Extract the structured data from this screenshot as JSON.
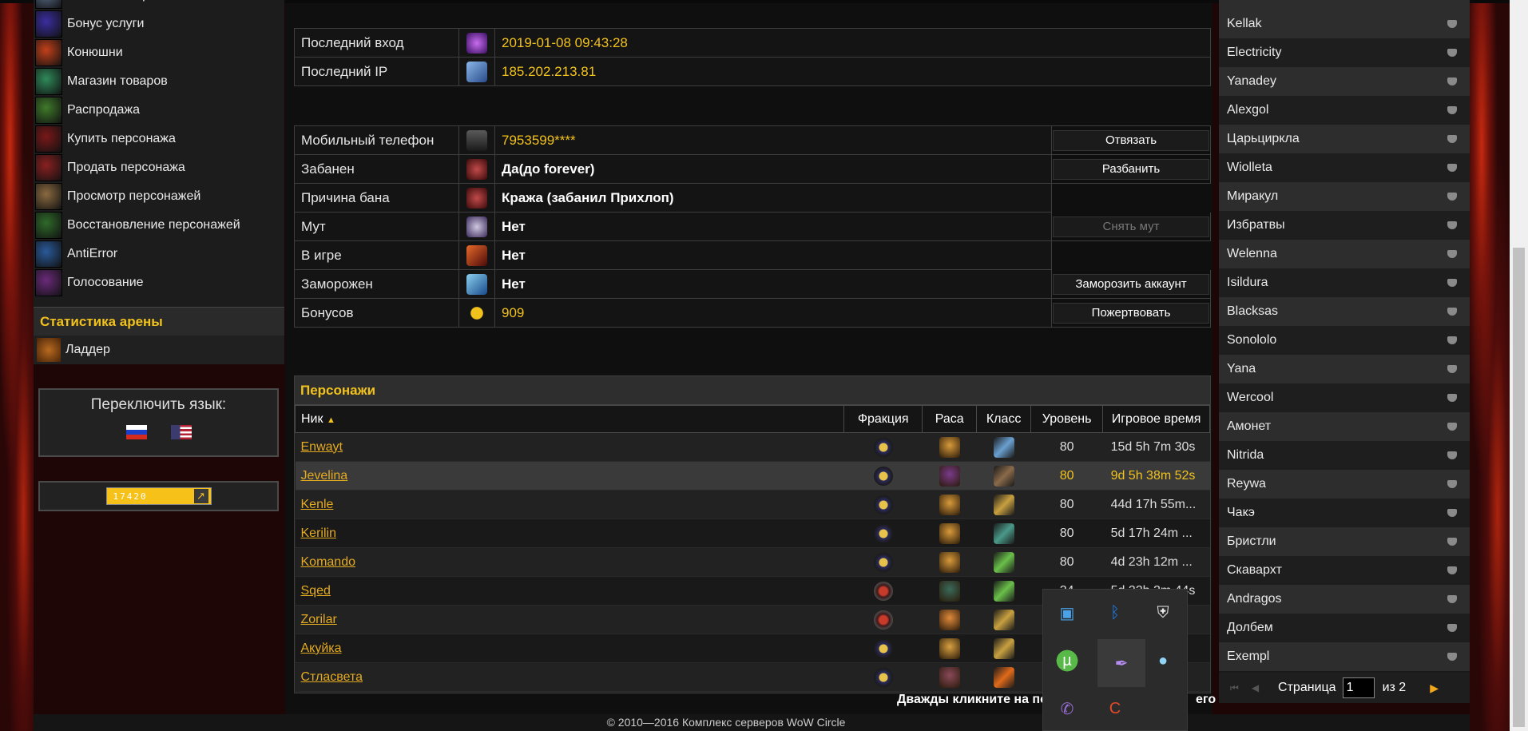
{
  "nav": {
    "items": [
      {
        "label": "Изменить пароль",
        "icon": "key-icon"
      },
      {
        "label": "Бонус услуги",
        "icon": "bonus-icon"
      },
      {
        "label": "Конюшни",
        "icon": "stable-icon"
      },
      {
        "label": "Магазин товаров",
        "icon": "shop-icon"
      },
      {
        "label": "Распродажа",
        "icon": "sale-icon"
      },
      {
        "label": "Купить персонажа",
        "icon": "buy-character-icon"
      },
      {
        "label": "Продать персонажа",
        "icon": "sell-character-icon"
      },
      {
        "label": "Просмотр персонажей",
        "icon": "view-characters-icon"
      },
      {
        "label": "Восстановление персонажей",
        "icon": "restore-characters-icon"
      },
      {
        "label": "AntiError",
        "icon": "antierror-icon"
      },
      {
        "label": "Голосование",
        "icon": "vote-icon"
      }
    ],
    "arena_header": "Статистика арены",
    "ladder": "Ладдер"
  },
  "lang": {
    "title": "Переключить язык:"
  },
  "counter": "17420",
  "login": [
    {
      "label": "Последний вход",
      "value": "2019-01-08 09:43:28"
    },
    {
      "label": "Последний IP",
      "value": "185.202.213.81"
    }
  ],
  "account": [
    {
      "label": "Мобильный телефон",
      "value": "7953599****",
      "button": "Отвязать"
    },
    {
      "label": "Забанен",
      "value": "Да(до forever)",
      "button": "Разбанить"
    },
    {
      "label": "Причина бана",
      "value": "Кража (забанил Прихлоп)",
      "button": ""
    },
    {
      "label": "Мут",
      "value": "Нет",
      "button": "Снять мут"
    },
    {
      "label": "В игре",
      "value": "Нет",
      "button": ""
    },
    {
      "label": "Заморожен",
      "value": "Нет",
      "button": "Заморозить аккаунт"
    },
    {
      "label": "Бонусов",
      "value": "909",
      "button": "Пожертвовать"
    }
  ],
  "characters": {
    "title": "Персонажи",
    "columns": {
      "name": "Ник",
      "faction": "Фракция",
      "race": "Раса",
      "class": "Класс",
      "level": "Уровень",
      "time": "Игровое время"
    },
    "rows": [
      {
        "name": "Enwayt",
        "level": "80",
        "time": "15d 5h 7m 30s"
      },
      {
        "name": "Jevelina",
        "level": "80",
        "time": "9d 5h 38m 52s"
      },
      {
        "name": "Kenle",
        "level": "80",
        "time": "44d 17h 55m..."
      },
      {
        "name": "Kerilin",
        "level": "80",
        "time": "5d 17h 24m ..."
      },
      {
        "name": "Komando",
        "level": "80",
        "time": "4d 23h 12m ..."
      },
      {
        "name": "Sqed",
        "level": "34",
        "time": "5d 22h 2m 44s"
      },
      {
        "name": "Zorilar",
        "level": "",
        "time": ""
      },
      {
        "name": "Акуйка",
        "level": "",
        "time": ""
      },
      {
        "name": "Стласвета",
        "level": "",
        "time": ""
      }
    ],
    "hint_left": "Дважды кликните на пер",
    "hint_right": "его"
  },
  "friends": {
    "names": [
      "Kellak",
      "Electricity",
      "Yanadey",
      "Alexgol",
      "Царьциркла",
      "Wiolleta",
      "Миракул",
      "Избратвы",
      "Welenna",
      "Isildura",
      "Blacksas",
      "Sonololo",
      "Yana",
      "Wercool",
      "Амонет",
      "Nitrida",
      "Reywa",
      "Чакэ",
      "Бристли",
      "Скавархт",
      "Andragos",
      "Долбем",
      "Exempl"
    ],
    "page_label": "Страница",
    "page_value": "1",
    "of_label": "из 2"
  },
  "footer": "© 2010—2016 Комплекс серверов WoW Circle"
}
